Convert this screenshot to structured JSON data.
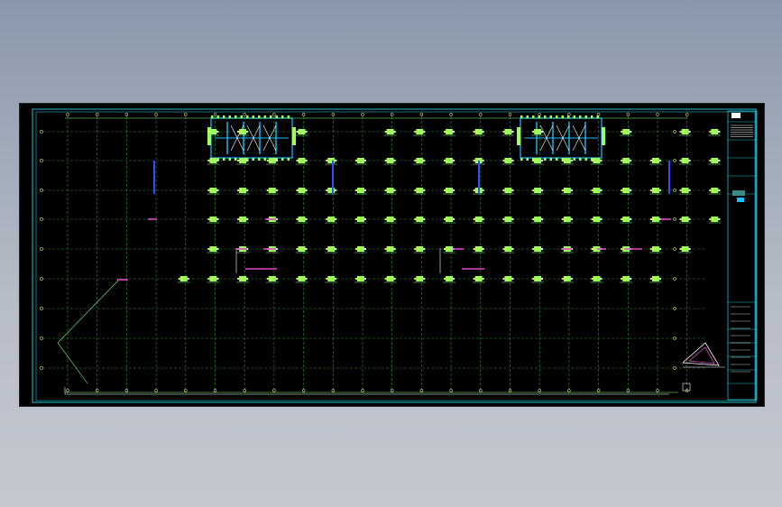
{
  "drawing": {
    "background": "#000000",
    "colors": {
      "border": "#20c0d0",
      "grid": "#2f8f2f",
      "grid_bubble": "#d8e070",
      "column": "#9cff5a",
      "wall": "#18c0ff",
      "rebar": "#e048c8",
      "dimension": "#7fff7f",
      "white": "#ffffff",
      "yellow": "#f0f040",
      "blue": "#3050ff"
    },
    "column_rows": [
      {
        "row": 1,
        "columns": [
          3,
          4,
          6,
          9,
          10,
          11,
          12,
          13,
          14,
          17,
          19,
          20
        ]
      },
      {
        "row": 2,
        "columns": [
          3,
          4,
          5,
          6,
          7,
          8,
          9,
          10,
          11,
          12,
          13,
          14,
          15,
          16,
          17,
          18,
          19,
          20
        ]
      },
      {
        "row": 3,
        "columns": [
          3,
          4,
          5,
          6,
          7,
          8,
          9,
          10,
          11,
          12,
          13,
          14,
          15,
          16,
          17,
          18,
          19,
          20
        ]
      },
      {
        "row": 4,
        "columns": [
          3,
          4,
          5,
          6,
          7,
          8,
          9,
          10,
          11,
          12,
          13,
          14,
          15,
          16,
          17,
          18,
          19,
          20
        ]
      },
      {
        "row": 5,
        "columns": [
          3,
          4,
          5,
          6,
          7,
          8,
          9,
          10,
          11,
          12,
          13,
          14,
          15,
          16,
          17,
          18,
          19
        ]
      },
      {
        "row": 6,
        "columns": [
          2,
          3,
          4,
          5,
          6,
          7,
          8,
          9,
          10,
          11,
          12,
          13,
          14,
          15,
          16,
          17,
          18
        ]
      }
    ],
    "core_blocks": [
      "core-left",
      "core-right"
    ]
  },
  "title_block": {
    "lines": [
      "",
      "",
      "",
      "",
      "",
      "",
      ""
    ]
  }
}
